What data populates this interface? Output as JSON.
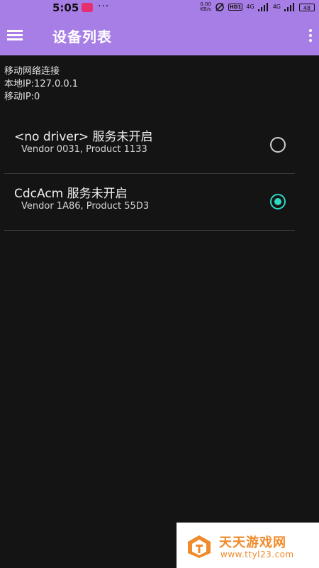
{
  "status_bar": {
    "time": "5:05",
    "dots": "···",
    "speed_top": "0.00",
    "speed_bottom": "KB/s",
    "hd_label": "HD1",
    "network_1": "4G",
    "network_2": "4G",
    "battery": "48"
  },
  "app_bar": {
    "title": "设备列表"
  },
  "info": {
    "line1": "移动网络连接",
    "line2": "本地IP:127.0.0.1",
    "line3": "移动IP:0"
  },
  "devices": [
    {
      "name": "<no driver> 服务未开启",
      "detail": "Vendor 0031, Product 1133",
      "selected": false
    },
    {
      "name": "CdcAcm 服务未开启",
      "detail": "Vendor 1A86, Product 55D3",
      "selected": true
    }
  ],
  "colors": {
    "app_bar": "#a77de6",
    "background": "#141414",
    "accent": "#2fd9c4",
    "watermark_brand": "#f08a2a"
  },
  "watermark": {
    "title": "天天游戏网",
    "url": "www.ttyl23.com"
  }
}
